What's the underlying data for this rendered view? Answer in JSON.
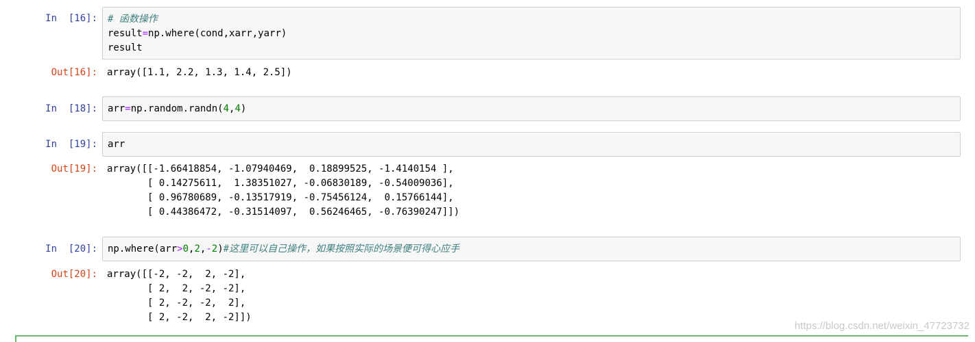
{
  "cells": [
    {
      "in_prompt": "In  [16]:",
      "code": {
        "line1": "# 函数操作",
        "line2_a": "result",
        "line2_op": "=",
        "line2_b": "np.where(cond,xarr,yarr)",
        "line3": "result"
      },
      "out_prompt": "Out[16]:",
      "output": "array([1.1, 2.2, 1.3, 1.4, 2.5])"
    },
    {
      "in_prompt": "In  [18]:",
      "code": {
        "a": "arr",
        "op": "=",
        "b": "np.random.randn(",
        "n1": "4",
        "comma": ",",
        "n2": "4",
        "c": ")"
      }
    },
    {
      "in_prompt": "In  [19]:",
      "code": {
        "line1": "arr"
      },
      "out_prompt": "Out[19]:",
      "output": "array([[-1.66418854, -1.07940469,  0.18899525, -1.4140154 ],\n       [ 0.14275611,  1.38351027, -0.06830189, -0.54009036],\n       [ 0.96780689, -0.13517919, -0.75456124,  0.15766144],\n       [ 0.44386472, -0.31514097,  0.56246465, -0.76390247]])"
    },
    {
      "in_prompt": "In  [20]:",
      "code": {
        "a": "np.where(arr",
        "op": ">",
        "n1": "0",
        "comma1": ",",
        "n2": "2",
        "comma2": ",",
        "op2": "-",
        "n3": "2",
        "c": ")",
        "comment": "#这里可以自己操作，如果按照实际的场景便可得心应手"
      },
      "out_prompt": "Out[20]:",
      "output": "array([[-2, -2,  2, -2],\n       [ 2,  2, -2, -2],\n       [ 2, -2, -2,  2],\n       [ 2, -2,  2, -2]])"
    }
  ],
  "watermark": "https://blog.csdn.net/weixin_47723732",
  "colors": {
    "in_prompt": "#303f9f",
    "out_prompt": "#d84315",
    "comment": "#408080",
    "operator": "#aa22ff",
    "number": "#008000",
    "selected_border": "#66bb6a"
  }
}
